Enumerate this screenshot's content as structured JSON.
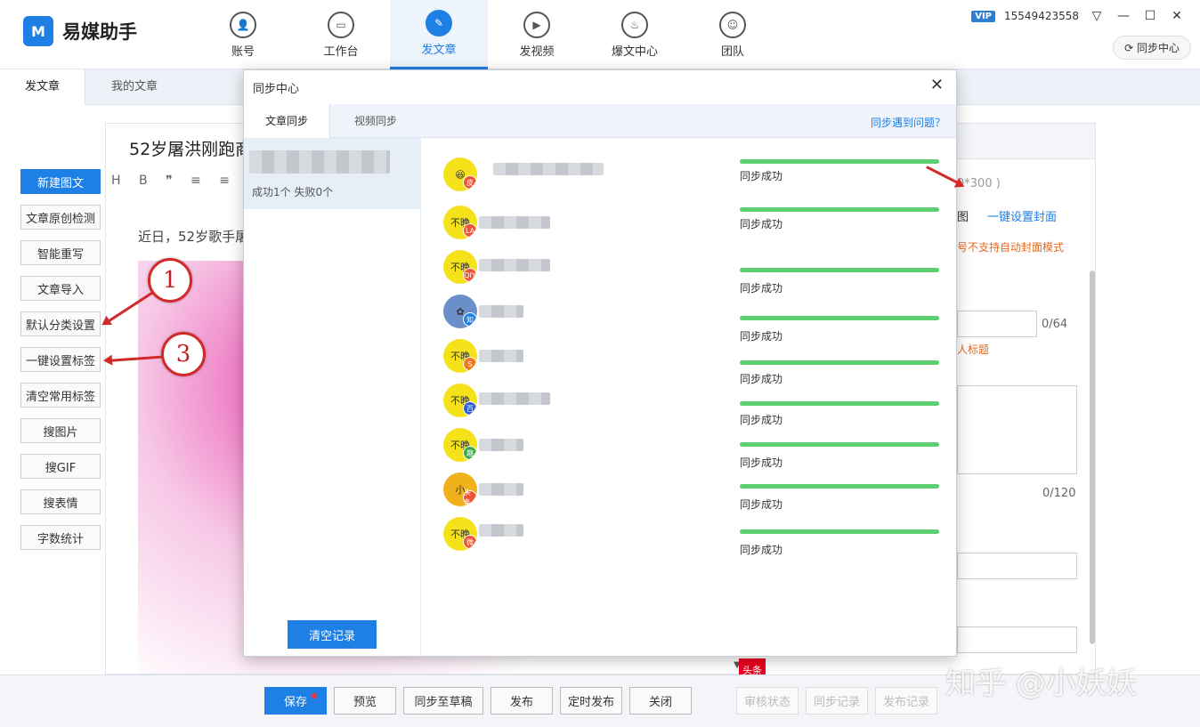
{
  "app": {
    "logo_mark": "M",
    "name": "易媒助手"
  },
  "nav": [
    {
      "label": "账号",
      "icon": "user-icon",
      "glyph": "👤"
    },
    {
      "label": "工作台",
      "icon": "monitor-icon",
      "glyph": "▭"
    },
    {
      "label": "发文章",
      "icon": "feather-icon",
      "glyph": "✎"
    },
    {
      "label": "发视频",
      "icon": "play-icon",
      "glyph": "▶"
    },
    {
      "label": "爆文中心",
      "icon": "fire-icon",
      "glyph": "♨"
    },
    {
      "label": "团队",
      "icon": "team-icon",
      "glyph": "☺"
    }
  ],
  "user": {
    "vip": "VIP",
    "phone": "15549423558"
  },
  "sync_center_button": "同步中心",
  "tabs": [
    "发文章",
    "我的文章"
  ],
  "left_tools": [
    "新建图文",
    "文章原创检测",
    "智能重写",
    "文章导入",
    "默认分类设置",
    "一键设置标签",
    "清空常用标签",
    "搜图片",
    "搜GIF",
    "搜表情",
    "字数统计"
  ],
  "editor": {
    "title": "52岁屠洪刚跑商",
    "toolbar": "H B ❞ ≡ ≡ — ⊏",
    "body_text": "近日，52岁歌手屠"
  },
  "right_panel": {
    "size_hint": "0*300 )",
    "cover_tab_fragment": "图",
    "one_click_cover": "一键设置封面",
    "cover_warning": "号不支持自动封面模式",
    "title_counter": "0/64",
    "title_hint": "人标题",
    "summary_counter": "0/120"
  },
  "bottom_buttons": [
    "保存",
    "预览",
    "同步至草稿",
    "发布",
    "定时发布",
    "关闭",
    "审核状态",
    "同步记录",
    "发布记录"
  ],
  "toutiao_badge": "头条",
  "modal": {
    "title": "同步中心",
    "tabs": [
      "文章同步",
      "视频同步"
    ],
    "help_link": "同步遇到问题？",
    "record_stat": "成功1个 失败0个",
    "clear_button": "清空记录",
    "rows": [
      {
        "avatar_text": "😆",
        "badge": "皮",
        "status": "同步成功",
        "progress": 1.0
      },
      {
        "avatar_text": "不晚",
        "badge": "LA",
        "status": "同步成功",
        "progress": 1.0
      },
      {
        "avatar_text": "不晚",
        "badge": "QIY",
        "status": "同步成功",
        "progress": 1.0
      },
      {
        "avatar_text": "✿",
        "badge": "知",
        "status": "同步成功",
        "progress": 1.0
      },
      {
        "avatar_text": "不晚",
        "badge": "S",
        "status": "同步成功",
        "progress": 1.0
      },
      {
        "avatar_text": "不晚",
        "badge": "百",
        "status": "同步成功",
        "progress": 1.0
      },
      {
        "avatar_text": "不晚",
        "badge": "趣",
        "status": "同步成功",
        "progress": 1.0
      },
      {
        "avatar_text": "小",
        "badge": "头条",
        "status": "同步成功",
        "progress": 1.0
      },
      {
        "avatar_text": "不晚",
        "badge": "微",
        "status": "同步成功",
        "progress": 1.0
      }
    ]
  },
  "annotations": [
    "1",
    "3"
  ],
  "watermark": "知乎 @小妖妖",
  "colors": {
    "accent": "#1e7fe5",
    "success": "#5ccf6f",
    "annotation": "#d12a2a"
  }
}
